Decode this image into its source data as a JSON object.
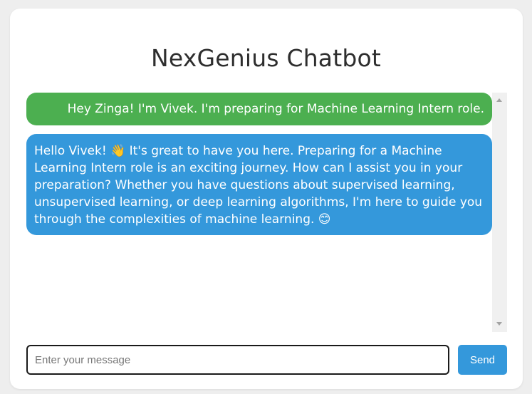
{
  "app": {
    "title": "NexGenius Chatbot"
  },
  "chat": {
    "messages": [
      {
        "role": "user",
        "text": "Hey Zinga! I'm Vivek. I'm preparing for Machine Learning Intern role."
      },
      {
        "role": "bot",
        "text": "Hello Vivek!  👋 It's great to have you here. Preparing for a Machine\nLearning Intern role is an exciting journey. How can I assist you in your\npreparation? Whether you have questions about supervised learning,\nunsupervised learning, or deep learning algorithms, I'm here to guide you\nthrough the complexities of machine learning. 😊"
      }
    ]
  },
  "composer": {
    "placeholder": "Enter your message",
    "value": "",
    "send_label": "Send"
  },
  "colors": {
    "user_bubble": "#4caf50",
    "bot_bubble": "#3498db",
    "send_button": "#3498db"
  }
}
